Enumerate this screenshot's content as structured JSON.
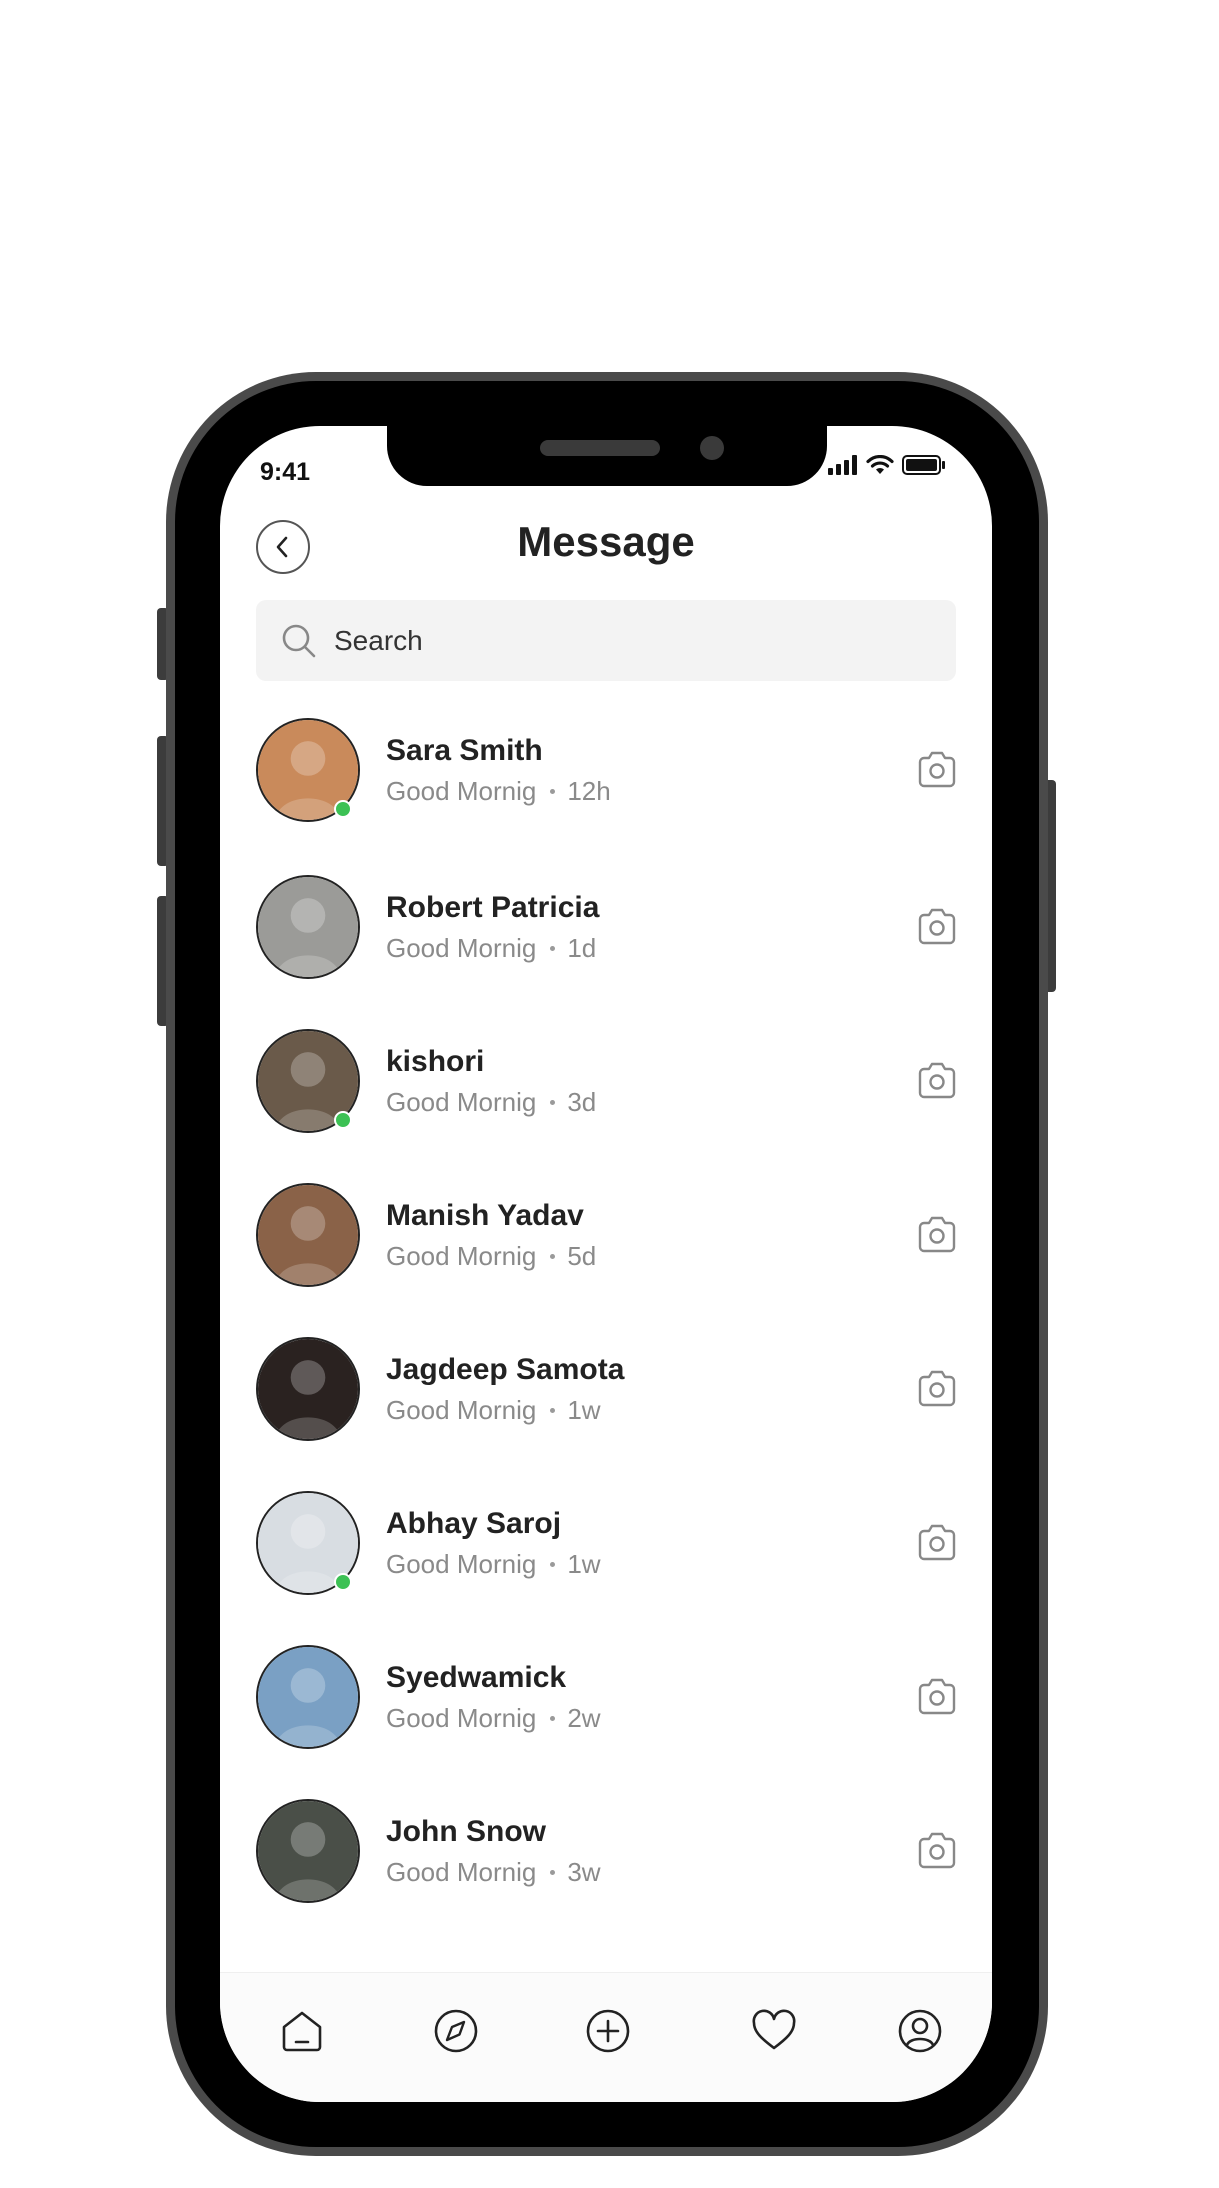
{
  "status_bar": {
    "time": "9:41"
  },
  "header": {
    "title": "Message",
    "back_icon": "chevron-left-icon"
  },
  "search": {
    "placeholder": "Search",
    "icon": "search-icon"
  },
  "conversations": [
    {
      "name": "Sara Smith",
      "message": "Good Mornig",
      "time": "12h",
      "online": true,
      "avatar_color": "#c98a5b"
    },
    {
      "name": "Robert Patricia",
      "message": "Good Mornig",
      "time": "1d",
      "online": false,
      "avatar_color": "#9b9b98"
    },
    {
      "name": "kishori",
      "message": "Good Mornig",
      "time": "3d",
      "online": true,
      "avatar_color": "#6a5a4a"
    },
    {
      "name": "Manish Yadav",
      "message": "Good Mornig",
      "time": "5d",
      "online": false,
      "avatar_color": "#8a6248"
    },
    {
      "name": "Jagdeep Samota",
      "message": "Good Mornig",
      "time": "1w",
      "online": false,
      "avatar_color": "#2a2220"
    },
    {
      "name": "Abhay Saroj",
      "message": "Good Mornig",
      "time": "1w",
      "online": true,
      "avatar_color": "#d8dde2"
    },
    {
      "name": "Syedwamick",
      "message": "Good Mornig",
      "time": "2w",
      "online": false,
      "avatar_color": "#7aa0c4"
    },
    {
      "name": "John Snow",
      "message": "Good Mornig",
      "time": "3w",
      "online": false,
      "avatar_color": "#4a4f48"
    }
  ],
  "tabbar": {
    "items": [
      "home-icon",
      "compass-icon",
      "add-icon",
      "heart-icon",
      "profile-icon"
    ]
  },
  "colors": {
    "online": "#3cc154",
    "text_primary": "#222222",
    "text_secondary": "#8a8a8a",
    "search_bg": "#f3f3f3"
  }
}
